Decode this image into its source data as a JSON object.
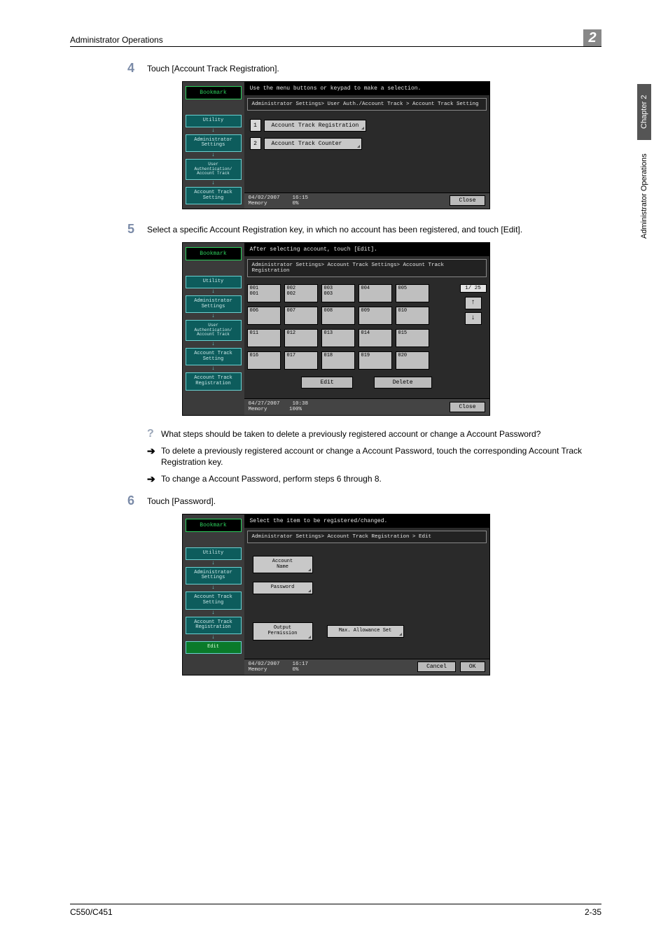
{
  "header": {
    "title": "Administrator Operations",
    "chapter_num": "2"
  },
  "side_tab": {
    "dark": "Chapter 2",
    "light": "Administrator Operations"
  },
  "steps": {
    "s4": {
      "num": "4",
      "text": "Touch [Account Track Registration]."
    },
    "s5": {
      "num": "5",
      "text": "Select a specific Account Registration key, in which no account has been registered, and touch [Edit]."
    },
    "s6": {
      "num": "6",
      "text": "Touch [Password]."
    }
  },
  "qa": {
    "q": "What steps should be taken to delete a previously registered account or change a Account Password?",
    "a1": "To delete a previously registered account or change a Account Password, touch the corresponding Account Track Registration key.",
    "a2": "To change a Account Password, perform steps 6 through 8."
  },
  "shot1": {
    "top": "Use the menu buttons or keypad to make a selection.",
    "crumb": "Administrator Settings> User Auth./Account Track > Account Track Setting",
    "bookmark": "Bookmark",
    "nav": [
      "Utility",
      "Administrator\nSettings",
      "User\nAuthentication/\nAccount Track",
      "Account Track\nSetting"
    ],
    "items": [
      {
        "num": "1",
        "label": "Account Track Registration"
      },
      {
        "num": "2",
        "label": "Account Track Counter"
      }
    ],
    "status_date": "04/02/2007",
    "status_time": "16:15",
    "status_mem": "Memory",
    "status_pct": "0%",
    "close": "Close"
  },
  "shot2": {
    "top": "After selecting account, touch [Edit].",
    "crumb": "Administrator Settings> Account Track Settings> Account Track Registration",
    "bookmark": "Bookmark",
    "nav": [
      "Utility",
      "Administrator\nSettings",
      "User\nAuthentication/\nAccount Track",
      "Account Track\nSetting",
      "Account Track\nRegistration"
    ],
    "page_ind": "1/ 25",
    "grid": [
      [
        {
          "a": "001",
          "b": "001"
        },
        {
          "a": "002",
          "b": "002"
        },
        {
          "a": "003",
          "b": "003"
        },
        {
          "a": "004",
          "b": ""
        },
        {
          "a": "005",
          "b": ""
        }
      ],
      [
        {
          "a": "006",
          "b": ""
        },
        {
          "a": "007",
          "b": ""
        },
        {
          "a": "008",
          "b": ""
        },
        {
          "a": "009",
          "b": ""
        },
        {
          "a": "010",
          "b": ""
        }
      ],
      [
        {
          "a": "011",
          "b": ""
        },
        {
          "a": "012",
          "b": ""
        },
        {
          "a": "013",
          "b": ""
        },
        {
          "a": "014",
          "b": ""
        },
        {
          "a": "015",
          "b": ""
        }
      ],
      [
        {
          "a": "016",
          "b": ""
        },
        {
          "a": "017",
          "b": ""
        },
        {
          "a": "018",
          "b": ""
        },
        {
          "a": "019",
          "b": ""
        },
        {
          "a": "020",
          "b": ""
        }
      ]
    ],
    "edit": "Edit",
    "delete": "Delete",
    "status_date": "04/27/2007",
    "status_time": "10:38",
    "status_mem": "Memory",
    "status_pct": "100%",
    "close": "Close"
  },
  "shot3": {
    "top": "Select the item to be registered/changed.",
    "crumb": "Administrator Settings> Account Track Registration > Edit",
    "bookmark": "Bookmark",
    "nav": [
      "Utility",
      "Administrator\nSettings",
      "Account Track\nSetting",
      "Account Track\nRegistration",
      "Edit"
    ],
    "btn_account": "Account\nName",
    "btn_password": "Password",
    "btn_output": "Output\nPermission",
    "btn_max": "Max. Allowance Set",
    "status_date": "04/02/2007",
    "status_time": "16:17",
    "status_mem": "Memory",
    "status_pct": "0%",
    "cancel": "Cancel",
    "ok": "OK"
  },
  "footer": {
    "left": "C550/C451",
    "right": "2-35"
  }
}
